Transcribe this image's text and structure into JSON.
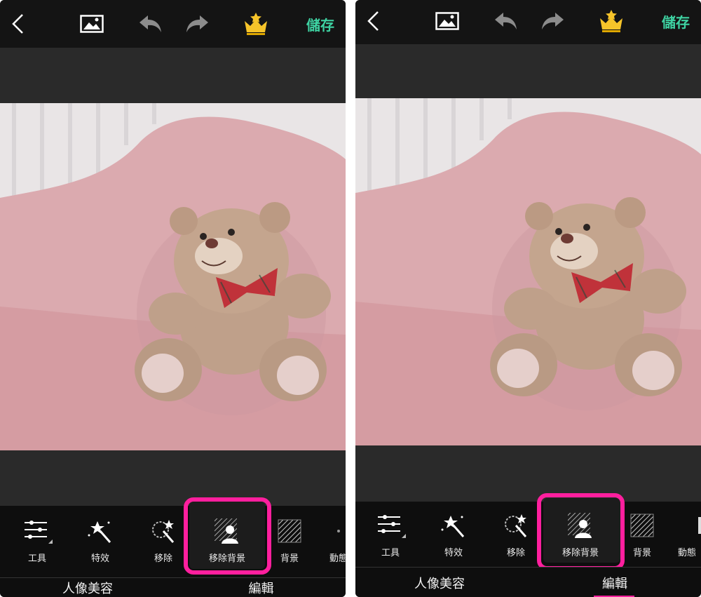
{
  "left": {
    "topbar": {
      "back_icon": "chevron-left-icon",
      "gallery_icon": "image-icon",
      "undo_icon": "undo-icon",
      "redo_icon": "redo-icon",
      "premium_icon": "crown-icon",
      "save_label": "儲存"
    },
    "tools": [
      {
        "label": "工具",
        "icon": "sliders-icon"
      },
      {
        "label": "特效",
        "icon": "magic-wand-icon"
      },
      {
        "label": "移除",
        "icon": "eraser-wand-icon"
      },
      {
        "label": "移除背景",
        "icon": "remove-background-icon"
      },
      {
        "label": "背景",
        "icon": "hatched-background-icon"
      },
      {
        "label": "動態",
        "icon": "animation-icon"
      }
    ],
    "nav": [
      {
        "label": "人像美容"
      },
      {
        "label": "編輯"
      }
    ]
  },
  "right": {
    "topbar": {
      "back_icon": "chevron-left-icon",
      "gallery_icon": "image-icon",
      "undo_icon": "undo-icon",
      "redo_icon": "redo-icon",
      "premium_icon": "crown-icon",
      "save_label": "儲存"
    },
    "tools": [
      {
        "label": "工具",
        "icon": "sliders-icon"
      },
      {
        "label": "特效",
        "icon": "magic-wand-icon"
      },
      {
        "label": "移除",
        "icon": "eraser-wand-icon"
      },
      {
        "label": "移除背景",
        "icon": "remove-background-icon"
      },
      {
        "label": "背景",
        "icon": "hatched-background-icon"
      },
      {
        "label": "動態",
        "icon": "animation-icon"
      }
    ],
    "nav": [
      {
        "label": "人像美容"
      },
      {
        "label": "編輯",
        "active": true
      }
    ]
  },
  "colors": {
    "accent": "#3ed2a2",
    "highlight": "#ff1f9e",
    "background": "#242424"
  }
}
